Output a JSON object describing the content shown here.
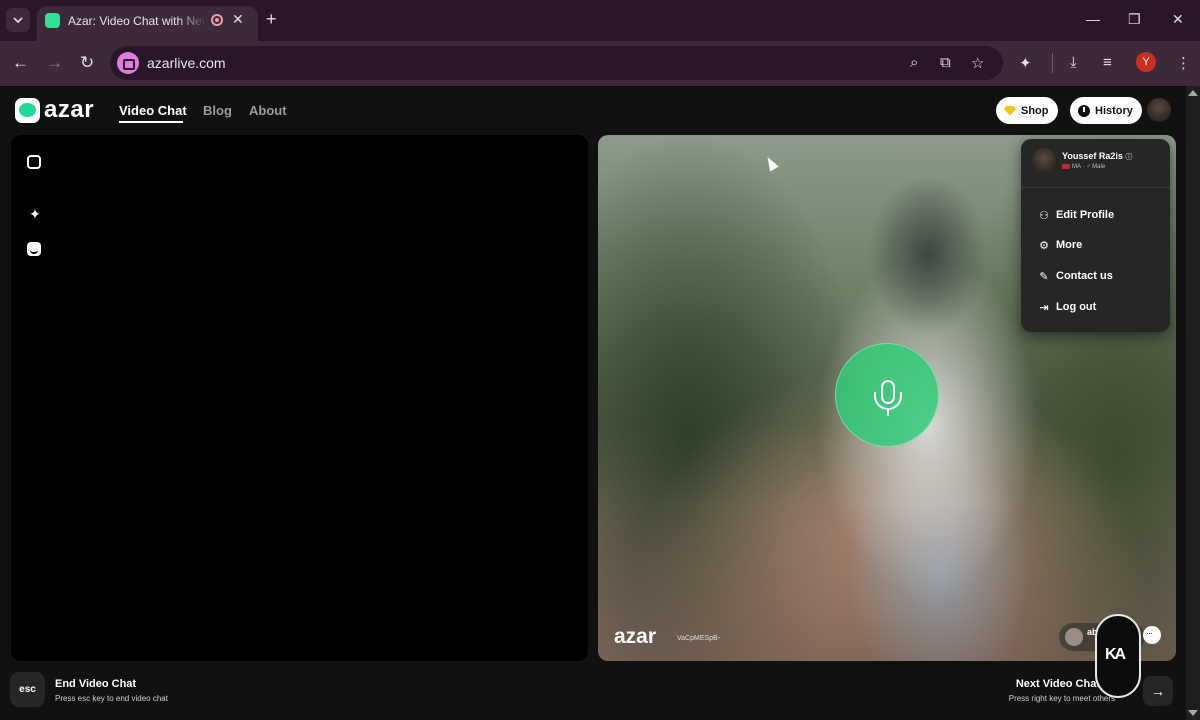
{
  "browser": {
    "tab": {
      "title": "Azar: Video Chat with New People",
      "close_glyph": "✕"
    },
    "new_tab_glyph": "+",
    "url": "azarlive.com",
    "profile_initial": "Y",
    "window": {
      "minimize": "—",
      "maximize": "❐",
      "close": "✕"
    }
  },
  "site_header": {
    "logo_text": "azar",
    "nav": [
      {
        "label": "Video Chat",
        "active": true
      },
      {
        "label": "Blog",
        "active": false
      },
      {
        "label": "About",
        "active": false
      }
    ],
    "shop_label": "Shop",
    "history_label": "History"
  },
  "peer": {
    "logo_text": "azar",
    "session_id": "VaCpMESpB-",
    "chip_name": "ab"
  },
  "profile_menu": {
    "name": "Youssef Ra2is",
    "country": "MA",
    "gender": "Male",
    "items": [
      {
        "label": "Edit Profile",
        "icon": "person-icon"
      },
      {
        "label": "More",
        "icon": "gear-icon"
      },
      {
        "label": "Contact us",
        "icon": "pencil-icon"
      },
      {
        "label": "Log out",
        "icon": "logout-icon"
      }
    ]
  },
  "bottom_bar": {
    "esc_key": "esc",
    "end_title": "End Video Chat",
    "end_sub": "Press esc key to end video chat",
    "next_title": "Next Video Chat",
    "next_sub": "Press right key to meet others",
    "next_arrow": "→"
  },
  "colors": {
    "brand_green": "#23d69a",
    "mic_green": "#2ecc78",
    "tabbar": "#2a1629",
    "toolbar": "#3c2a3b"
  }
}
